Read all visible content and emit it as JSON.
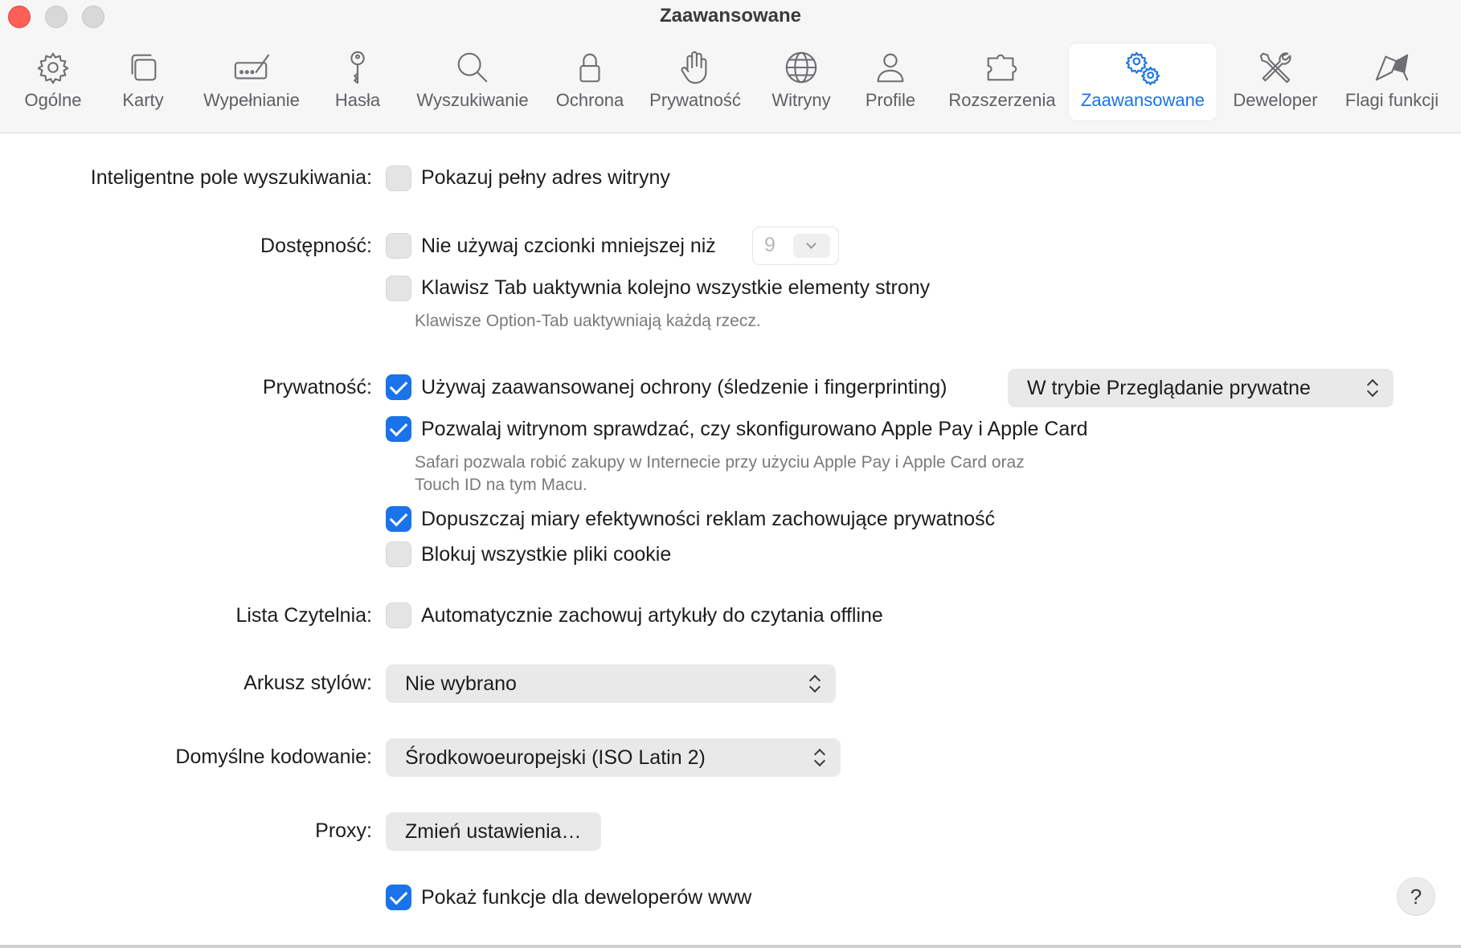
{
  "window": {
    "title": "Zaawansowane"
  },
  "colors": {
    "accent": "#1a73e8",
    "close_button": "#ff5f57"
  },
  "toolbar": {
    "tabs": [
      {
        "label": "Ogólne",
        "icon": "gear-icon",
        "active": false
      },
      {
        "label": "Karty",
        "icon": "tabs-icon",
        "active": false
      },
      {
        "label": "Wypełnianie",
        "icon": "autofill-pencil-icon",
        "active": false
      },
      {
        "label": "Hasła",
        "icon": "key-icon",
        "active": false
      },
      {
        "label": "Wyszukiwanie",
        "icon": "magnifier-icon",
        "active": false
      },
      {
        "label": "Ochrona",
        "icon": "lock-icon",
        "active": false
      },
      {
        "label": "Prywatność",
        "icon": "hand-icon",
        "active": false
      },
      {
        "label": "Witryny",
        "icon": "globe-icon",
        "active": false
      },
      {
        "label": "Profile",
        "icon": "person-icon",
        "active": false
      },
      {
        "label": "Rozszerzenia",
        "icon": "puzzle-icon",
        "active": false
      },
      {
        "label": "Zaawansowane",
        "icon": "gears-icon",
        "active": true
      },
      {
        "label": "Deweloper",
        "icon": "tools-icon",
        "active": false
      },
      {
        "label": "Flagi funkcji",
        "icon": "flags-icon",
        "active": false
      }
    ]
  },
  "settings": {
    "smart_search": {
      "label": "Inteligentne pole wyszukiwania:",
      "show_full_address": {
        "text": "Pokazuj pełny adres witryny",
        "checked": false
      }
    },
    "accessibility": {
      "label": "Dostępność:",
      "min_font": {
        "text": "Nie używaj czcionki mniejszej niż",
        "checked": false,
        "value": "9"
      },
      "tab_key": {
        "text": "Klawisz Tab uaktywnia kolejno wszystkie elementy strony",
        "checked": false
      },
      "hint": "Klawisze Option-Tab uaktywniają każdą rzecz."
    },
    "privacy": {
      "label": "Prywatność:",
      "advanced_protection": {
        "text": "Używaj zaawansowanej ochrony (śledzenie i fingerprinting)",
        "checked": true
      },
      "protection_mode": "W trybie Przeglądanie prywatne",
      "apple_pay": {
        "text": "Pozwalaj witrynom sprawdzać, czy skonfigurowano Apple Pay i Apple Card",
        "checked": true
      },
      "apple_pay_hint_line1": "Safari pozwala robić zakupy w Internecie przy użyciu Apple Pay i Apple Card oraz",
      "apple_pay_hint_line2": "Touch ID na tym Macu.",
      "ad_measurement": {
        "text": "Dopuszczaj miary efektywności reklam zachowujące prywatność",
        "checked": true
      },
      "block_cookies": {
        "text": "Blokuj wszystkie pliki cookie",
        "checked": false
      }
    },
    "reading_list": {
      "label": "Lista Czytelnia:",
      "save_offline": {
        "text": "Automatycznie zachowuj artykuły do czytania offline",
        "checked": false
      }
    },
    "stylesheet": {
      "label": "Arkusz stylów:",
      "value": "Nie wybrano"
    },
    "encoding": {
      "label": "Domyślne kodowanie:",
      "value": "Środkowoeuropejski (ISO Latin 2)"
    },
    "proxy": {
      "label": "Proxy:",
      "button": "Zmień ustawienia…"
    },
    "developer": {
      "show_features": {
        "text": "Pokaż funkcje dla deweloperów www",
        "checked": true
      }
    },
    "help": "?"
  }
}
